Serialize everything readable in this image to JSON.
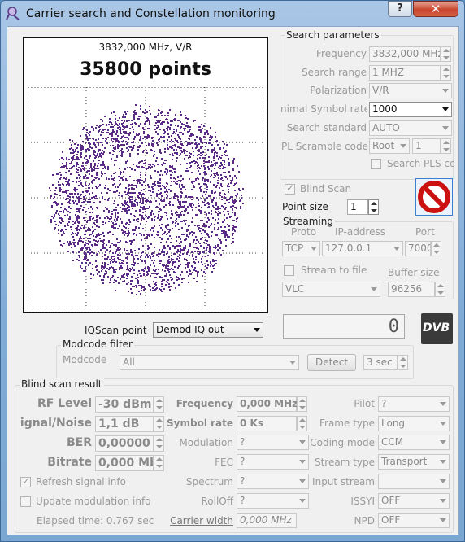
{
  "window": {
    "title": "Carrier search and Constellation monitoring",
    "help_label": "?",
    "close_label": "✕"
  },
  "constellation": {
    "header": "3832,000 MHz, V/R",
    "points_label": "35800 points",
    "dot_color": "#5b2a86"
  },
  "iqscan": {
    "label": "IQScan point",
    "value": "Demod IQ out"
  },
  "modcode_filter": {
    "title": "Modcode filter",
    "label": "Modcode",
    "value": "All",
    "detect_label": "Detect",
    "interval_value": "3 sec"
  },
  "search_parameters": {
    "title": "Search parameters",
    "frequency_label": "Frequency",
    "frequency_value": "3832,000 MHz",
    "search_range_label": "Search range",
    "search_range_value": "1 MHZ",
    "polarization_label": "Polarization",
    "polarization_value": "V/R",
    "min_symbol_rate_label": "nimal Symbol rate",
    "min_symbol_rate_value": "1000",
    "search_standard_label": "Search standard",
    "search_standard_value": "AUTO",
    "pl_scramble_label": "PL Scramble code",
    "pl_scramble_mode": "Root",
    "pl_scramble_value": "1",
    "search_pls_label": "Search PLS cc"
  },
  "blind_scan": {
    "label": "Blind Scan",
    "checked": true
  },
  "point_size": {
    "label": "Point size",
    "value": "1"
  },
  "streaming": {
    "title": "Streaming",
    "proto_header": "Proto",
    "ip_header": "IP-address",
    "port_header": "Port",
    "proto_value": "TCP",
    "ip_value": "127.0.0.1",
    "port_value": "7000",
    "stream_to_file_label": "Stream to file",
    "buffer_size_label": "Buffer size",
    "player_value": "VLC",
    "buffer_size_value": "96256"
  },
  "status_display": {
    "value": "0"
  },
  "dvb_logo": "DVB",
  "stop_icon_color": "#cc1111",
  "blind_scan_result": {
    "title": "Blind scan result",
    "rf_level_label": "RF Level",
    "rf_level_value": "-30 dBm",
    "snr_label": "ignal/Noise",
    "snr_value": "1,1 dB",
    "ber_label": "BER",
    "ber_value": "0,00000",
    "bitrate_label": "Bitrate",
    "bitrate_value": "0,000 Mb",
    "frequency_label": "Frequency",
    "frequency_value": "0,000 MHz",
    "symbol_rate_label": "Symbol rate",
    "symbol_rate_value": "0 Ks",
    "modulation_label": "Modulation",
    "modulation_value": "?",
    "fec_label": "FEC",
    "fec_value": "?",
    "spectrum_label": "Spectrum",
    "spectrum_value": "?",
    "rolloff_label": "RollOff",
    "rolloff_value": "?",
    "carrier_width_label": "Carrier width",
    "carrier_width_value": "0,000 MHz",
    "pilot_label": "Pilot",
    "pilot_value": "?",
    "frame_type_label": "Frame type",
    "frame_type_value": "Long",
    "coding_mode_label": "Coding mode",
    "coding_mode_value": "CCM",
    "stream_type_label": "Stream type",
    "stream_type_value": "Transport",
    "input_stream_label": "Input stream",
    "input_stream_value": "",
    "issyi_label": "ISSYI",
    "issyi_value": "OFF",
    "npd_label": "NPD",
    "npd_value": "OFF",
    "refresh_label": "Refresh signal info",
    "refresh_checked": true,
    "update_mod_label": "Update modulation info",
    "update_mod_checked": false,
    "elapsed_label": "Elapsed time: 0.767 sec"
  }
}
